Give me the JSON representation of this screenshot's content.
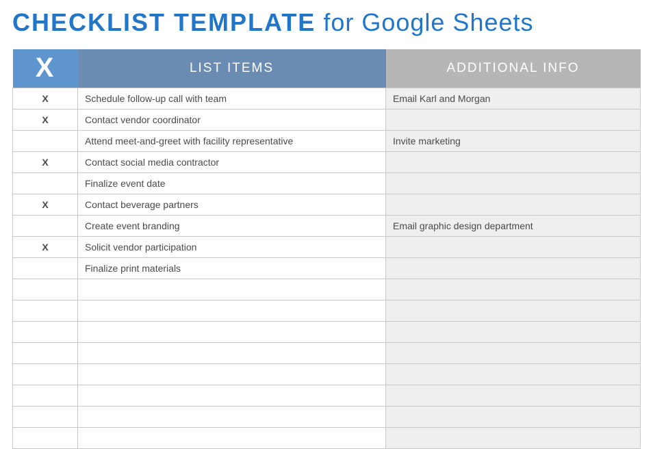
{
  "title": {
    "bold": "CHECKLIST TEMPLATE",
    "rest": " for Google Sheets"
  },
  "headers": {
    "check": "X",
    "item": "LIST ITEMS",
    "info": "ADDITIONAL INFO"
  },
  "rows": [
    {
      "check": "X",
      "item": "Schedule follow-up call with team",
      "info": "Email Karl and Morgan"
    },
    {
      "check": "X",
      "item": "Contact vendor coordinator",
      "info": ""
    },
    {
      "check": "",
      "item": "Attend meet-and-greet with facility representative",
      "info": "Invite marketing"
    },
    {
      "check": "X",
      "item": "Contact social media contractor",
      "info": ""
    },
    {
      "check": "",
      "item": "Finalize event date",
      "info": ""
    },
    {
      "check": "X",
      "item": "Contact beverage partners",
      "info": ""
    },
    {
      "check": "",
      "item": "Create event branding",
      "info": "Email graphic design department"
    },
    {
      "check": "X",
      "item": "Solicit vendor participation",
      "info": ""
    },
    {
      "check": "",
      "item": "Finalize print materials",
      "info": ""
    },
    {
      "check": "",
      "item": "",
      "info": ""
    },
    {
      "check": "",
      "item": "",
      "info": ""
    },
    {
      "check": "",
      "item": "",
      "info": ""
    },
    {
      "check": "",
      "item": "",
      "info": ""
    },
    {
      "check": "",
      "item": "",
      "info": ""
    },
    {
      "check": "",
      "item": "",
      "info": ""
    },
    {
      "check": "",
      "item": "",
      "info": ""
    },
    {
      "check": "",
      "item": "",
      "info": ""
    }
  ]
}
